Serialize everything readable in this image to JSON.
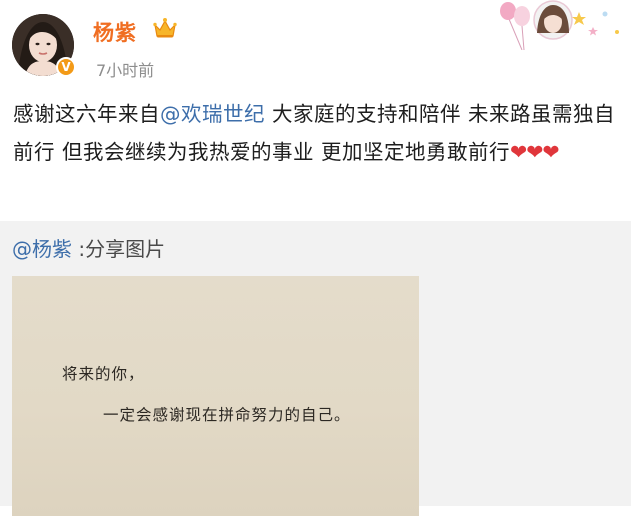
{
  "post": {
    "author_name": "杨紫",
    "timestamp": "7小时前",
    "text_before": "感谢这六年来自",
    "mention": "@欢瑞世纪",
    "text_after": " 大家庭的支持和陪伴 未来路虽需独自前行 但我会继续为我热爱的事业 更加坚定地勇敢前行",
    "hearts": "❤❤❤",
    "verified_mark": "V"
  },
  "repost": {
    "author_mention": "@杨紫",
    "caption": " :分享图片"
  },
  "shared_image": {
    "line1": "将来的你，",
    "line2": "一定会感谢现在拼命努力的自己。"
  },
  "icons": {
    "avatar": "user-avatar-photo",
    "crown": "crown-icon",
    "badge": "verified-badge-icon",
    "decoration": "balloon-card-decoration"
  },
  "colors": {
    "author_name": "#f06e22",
    "mention": "#3d6eaa",
    "hearts": "#e0363b",
    "repost_background": "#f2f2f2",
    "image_background": "#e2d9c6"
  }
}
